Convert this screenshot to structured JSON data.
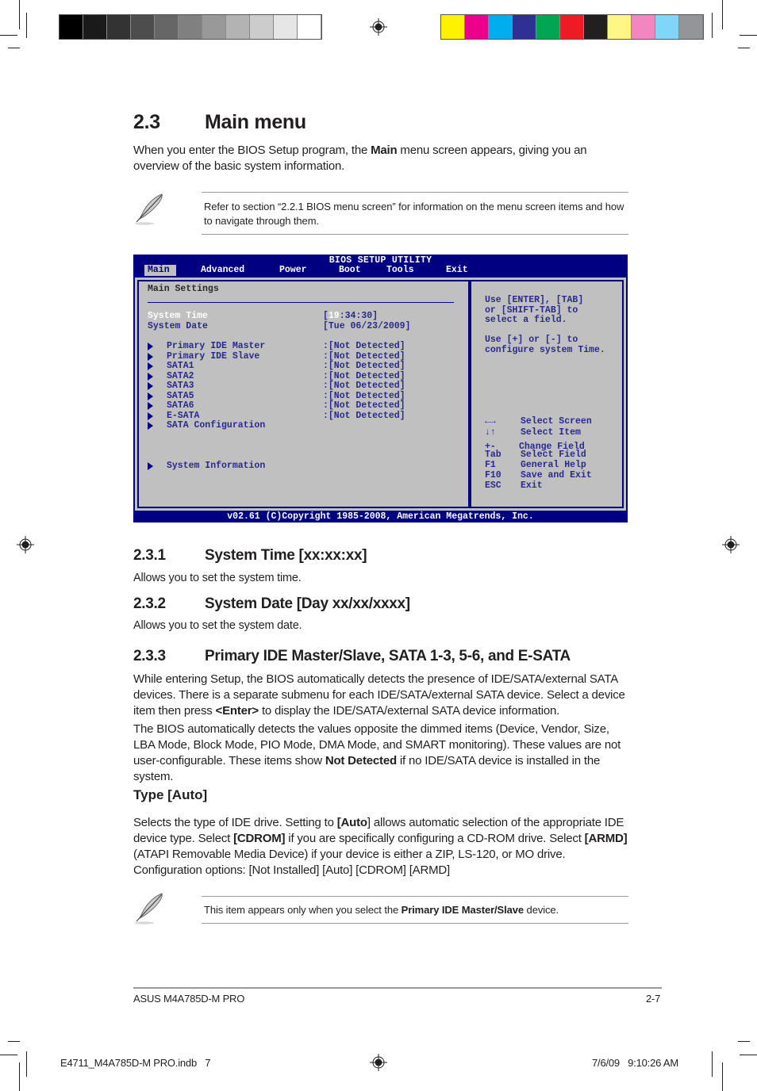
{
  "print_marks": {
    "grayscale_swatches": [
      "#000000",
      "#1a1a1a",
      "#333333",
      "#4d4d4d",
      "#666666",
      "#808080",
      "#999999",
      "#b3b3b3",
      "#cccccc",
      "#e6e6e6",
      "#ffffff"
    ],
    "color_swatches": [
      "#fff200",
      "#ec008c",
      "#00aeef",
      "#2e3192",
      "#00a651",
      "#ed1c24",
      "#231f20",
      "#fff685",
      "#f286c0",
      "#7fd6f7",
      "#939598"
    ]
  },
  "section": {
    "number": "2.3",
    "title": "Main menu",
    "intro_pre": "When you enter the BIOS Setup program, the ",
    "intro_bold": "Main",
    "intro_post": " menu screen appears, giving you an overview of the basic system information."
  },
  "note1": {
    "icon": "feather-pen-icon",
    "text": "Refer to section “2.2.1 BIOS menu screen” for information on the menu screen items and how to navigate through them."
  },
  "bios": {
    "title": "BIOS SETUP UTILITY",
    "menu": [
      "Main",
      "Advanced",
      "Power",
      "Boot",
      "Tools",
      "Exit"
    ],
    "active_menu": "Main",
    "panel_title": "Main Settings",
    "system_time_label": "System Time",
    "system_time_value_open": "[",
    "system_time_value_hl": "19",
    "system_time_value_rest": ":34:30]",
    "system_date_label": "System Date",
    "system_date_value": "[Tue 06/23/2009]",
    "devices": [
      {
        "label": "Primary IDE Master",
        "value": ":[Not Detected]"
      },
      {
        "label": "Primary IDE Slave",
        "value": ":[Not Detected]"
      },
      {
        "label": "SATA1",
        "value": ":[Not Detected]"
      },
      {
        "label": "SATA2",
        "value": ":[Not Detected]"
      },
      {
        "label": "SATA3",
        "value": ":[Not Detected]"
      },
      {
        "label": "SATA5",
        "value": ":[Not Detected]"
      },
      {
        "label": "SATA6",
        "value": ":[Not Detected]"
      },
      {
        "label": "E-SATA",
        "value": ":[Not Detected]"
      },
      {
        "label": "SATA Configuration",
        "value": ""
      }
    ],
    "system_information": "System Information",
    "help_lines": [
      "Use [ENTER], [TAB]",
      "or [SHIFT-TAB] to",
      "select a field.",
      "",
      "Use [+] or [-] to",
      "configure system Time."
    ],
    "keys": [
      {
        "key": "←→",
        "action": "Select Screen"
      },
      {
        "key": "↓↑",
        "action": "Select Item"
      },
      {
        "key": "+-",
        "action": "Change Field"
      },
      {
        "key": "Tab",
        "action": "Select Field"
      },
      {
        "key": "F1",
        "action": "General Help"
      },
      {
        "key": "F10",
        "action": "Save and Exit"
      },
      {
        "key": "ESC",
        "action": "Exit"
      }
    ],
    "footer": "v02.61 (C)Copyright 1985-2008, American Megatrends, Inc."
  },
  "s231": {
    "number": "2.3.1",
    "title": "System Time [xx:xx:xx]",
    "body": "Allows you to set the system time."
  },
  "s232": {
    "number": "2.3.2",
    "title": "System Date [Day xx/xx/xxxx]",
    "body": "Allows you to set the system date."
  },
  "s233": {
    "number": "2.3.3",
    "title": "Primary IDE Master/Slave, SATA 1-3, 5-6, and E-SATA",
    "p1_pre": "While entering Setup, the BIOS automatically detects the presence of IDE/SATA/external SATA devices. There is a separate submenu for each IDE/SATA/external SATA device. Select a device item then press ",
    "p1_bold": "<Enter>",
    "p1_post": " to display the IDE/SATA/external SATA device information.",
    "p2_pre": "The BIOS automatically detects the values opposite the dimmed items (Device, Vendor, Size, LBA Mode, Block Mode, PIO Mode, DMA Mode, and SMART monitoring). These values are not user-configurable. These items show ",
    "p2_bold": "Not Detected",
    "p2_post": " if no IDE/SATA device is installed in the system."
  },
  "type_auto": {
    "title": "Type [Auto]",
    "t1": "Selects the type of IDE drive. Setting to ",
    "b1": "[Auto",
    "t2": "] allows automatic selection of the appropriate IDE device type. Select ",
    "b2": "[CDROM]",
    "t3": " if you are specifically configuring a CD-ROM drive. Select ",
    "b3": "[ARMD]",
    "t4": " (ATAPI Removable Media Device) if your device is either a ZIP, LS-120, or MO drive. Configuration options: [Not Installed] [Auto] [CDROM] [ARMD]"
  },
  "note2": {
    "icon": "feather-pen-icon",
    "pre": "This item appears only when you select the ",
    "bold": "Primary IDE Master/Slave",
    "post": " device."
  },
  "footer": {
    "product": "ASUS M4A785D-M PRO",
    "page": "2-7",
    "slug_file": "E4711_M4A785D-M PRO.indb   7",
    "slug_date": "7/6/09   9:10:26 AM"
  }
}
